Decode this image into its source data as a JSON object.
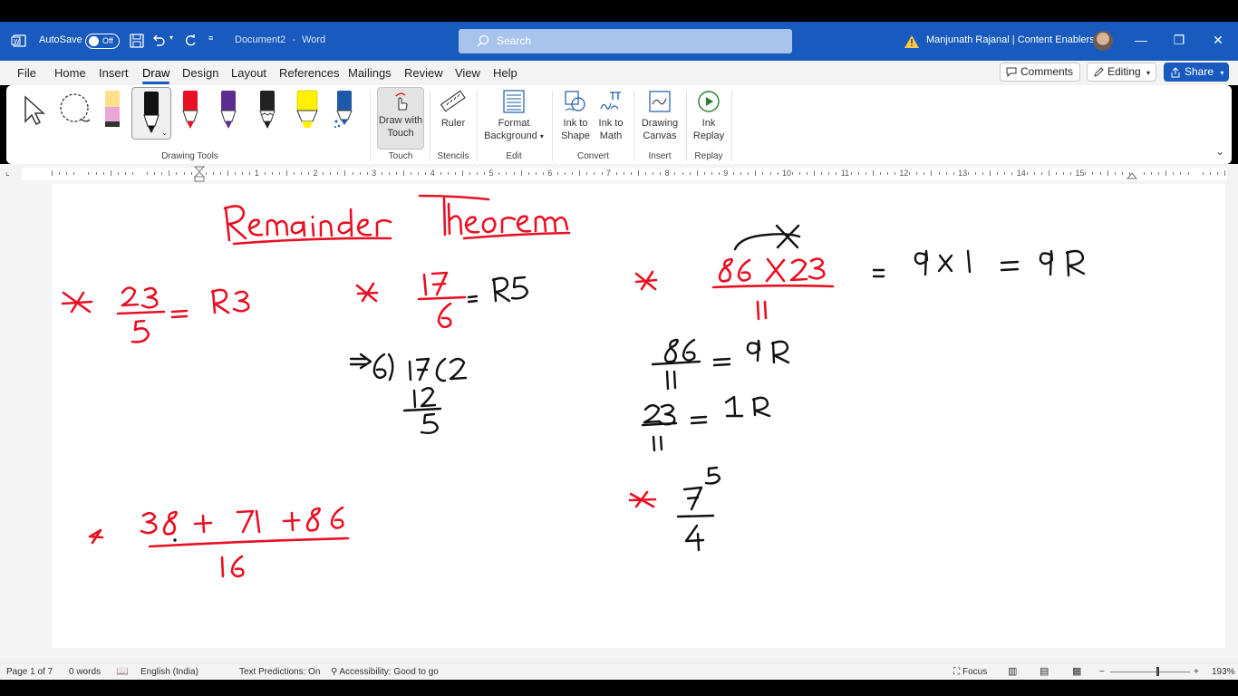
{
  "titlebar": {
    "autosave_label": "AutoSave",
    "autosave_state": "Off",
    "doc_title": "Document2",
    "separator": "-",
    "app_name": "Word",
    "search_placeholder": "Search",
    "user_name": "Manjunath Rajanal | Content Enablers",
    "accent_color": "#185abd"
  },
  "menu": {
    "tabs": [
      "File",
      "Home",
      "Insert",
      "Draw",
      "Design",
      "Layout",
      "References",
      "Mailings",
      "Review",
      "View",
      "Help"
    ],
    "active_tab": "Draw",
    "comments_label": "Comments",
    "editing_label": "Editing",
    "share_label": "Share"
  },
  "ribbon": {
    "groups": {
      "drawing_tools": "Drawing Tools",
      "touch": "Touch",
      "stencils": "Stencils",
      "edit": "Edit",
      "convert": "Convert",
      "insert": "Insert",
      "replay": "Replay"
    },
    "buttons": {
      "draw_with_touch_1": "Draw with",
      "draw_with_touch_2": "Touch",
      "ruler": "Ruler",
      "format_bg_1": "Format",
      "format_bg_2": "Background",
      "ink_to_shape_1": "Ink to",
      "ink_to_shape_2": "Shape",
      "ink_to_math_1": "Ink to",
      "ink_to_math_2": "Math",
      "drawing_canvas_1": "Drawing",
      "drawing_canvas_2": "Canvas",
      "ink_replay_1": "Ink",
      "ink_replay_2": "Replay"
    },
    "pens": [
      {
        "name": "pencil-tool",
        "color": "#ffe08a"
      },
      {
        "name": "black-pen",
        "color": "#111111"
      },
      {
        "name": "red-pen",
        "color": "#e81123"
      },
      {
        "name": "purple-pen",
        "color": "#5c2d91"
      },
      {
        "name": "black-pen-2",
        "color": "#222222"
      },
      {
        "name": "yellow-highlighter",
        "color": "#fff100"
      },
      {
        "name": "galaxy-pen",
        "color": "#1e5aa8"
      }
    ]
  },
  "ruler": {
    "numbers": [
      "1",
      "2",
      "3",
      "4",
      "5",
      "6",
      "7",
      "8",
      "9",
      "10",
      "11",
      "12",
      "13",
      "14",
      "15"
    ]
  },
  "document": {
    "ink_color_red": "#e81123",
    "ink_color_black": "#111111"
  },
  "status": {
    "page": "Page 1 of 7",
    "words": "0 words",
    "language": "English (India)",
    "predictions": "Text Predictions: On",
    "accessibility": "Accessibility: Good to go",
    "focus": "Focus",
    "zoom": "193%"
  }
}
